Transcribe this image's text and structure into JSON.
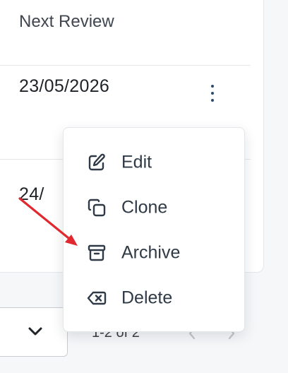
{
  "table": {
    "column_header": "Next Review",
    "rows": [
      {
        "next_review": "23/05/2026"
      },
      {
        "next_review": "24/"
      }
    ]
  },
  "pagination": {
    "range_label": "1-2 of 2"
  },
  "context_menu": {
    "items": [
      {
        "label": "Edit",
        "icon": "edit-icon"
      },
      {
        "label": "Clone",
        "icon": "clone-icon"
      },
      {
        "label": "Archive",
        "icon": "archive-icon"
      },
      {
        "label": "Delete",
        "icon": "delete-icon"
      }
    ]
  },
  "colors": {
    "annotation_arrow": "#e0282e",
    "kebab": "#2b4c6b",
    "text": "#2f3a46"
  }
}
